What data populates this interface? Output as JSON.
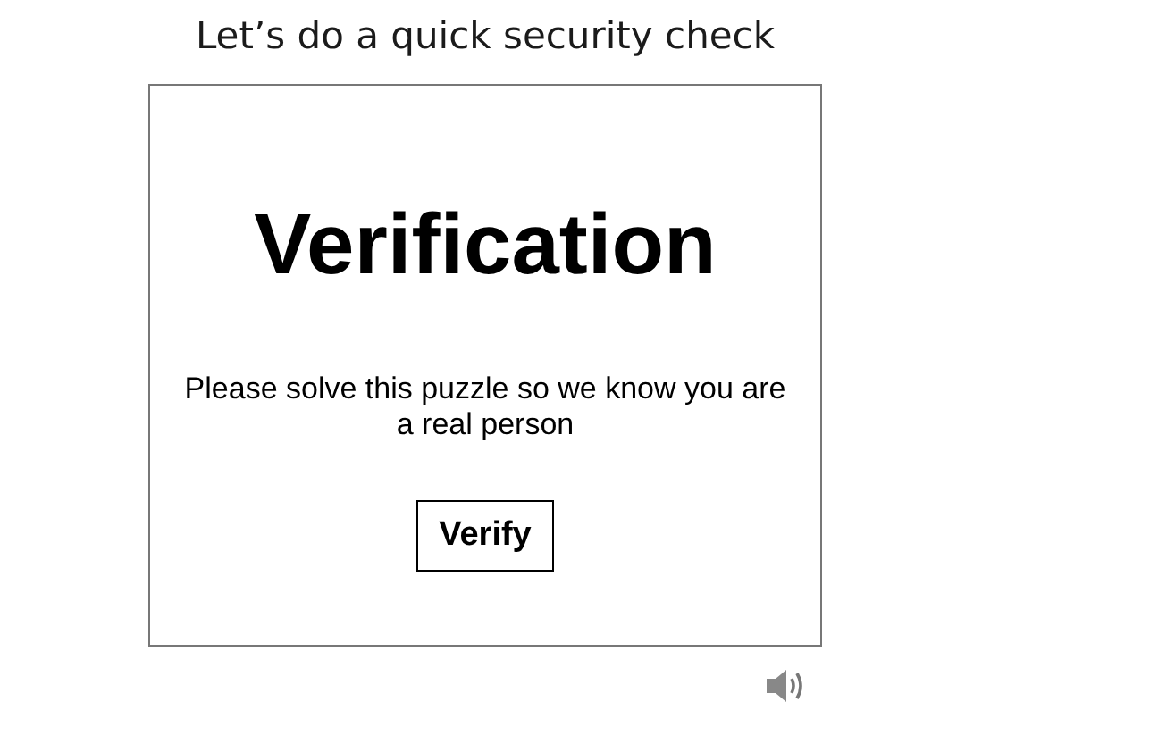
{
  "heading": "Let’s do a quick security check",
  "challenge": {
    "title": "Verification",
    "message": "Please solve this puzzle so we know you are a real person",
    "button": "Verify"
  }
}
